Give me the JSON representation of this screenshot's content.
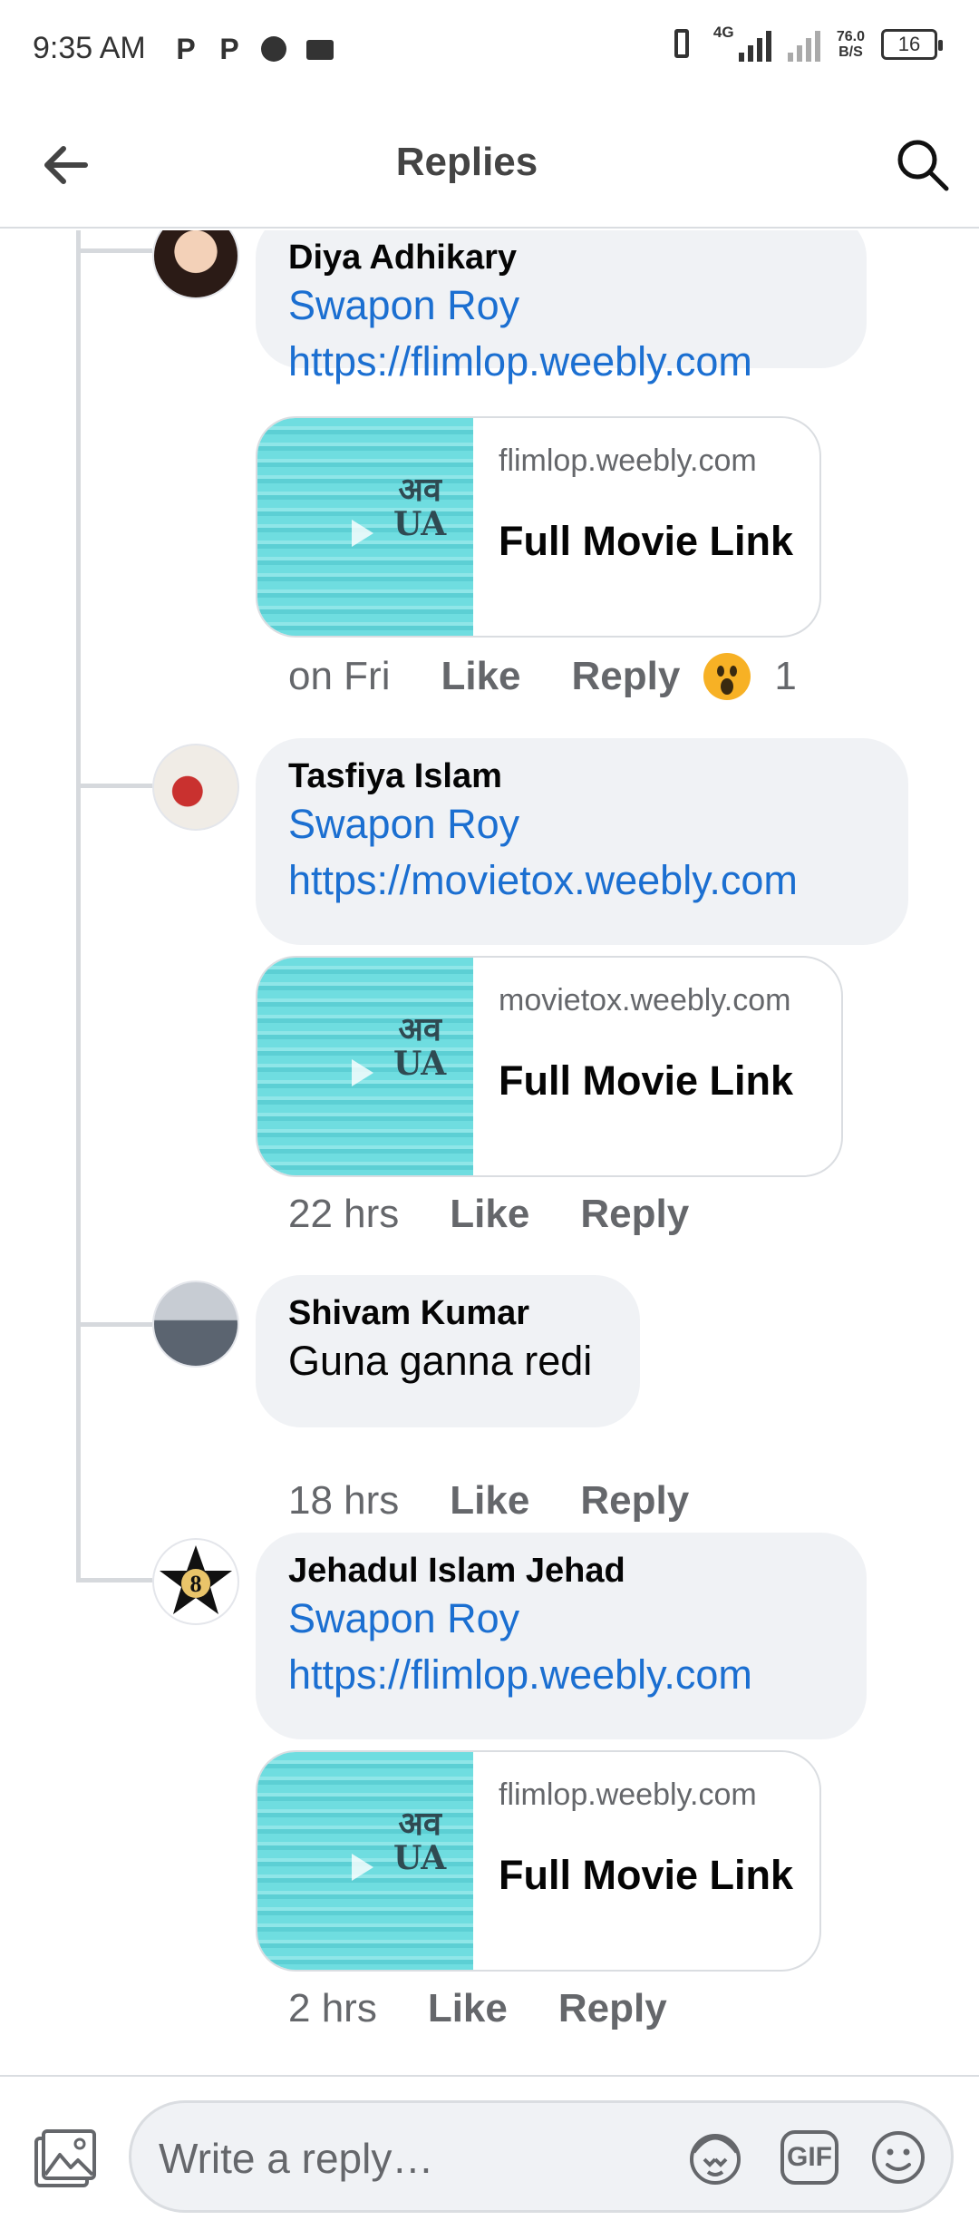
{
  "status_bar": {
    "time": "9:35 AM",
    "network": "4G",
    "speed_value": "76.0",
    "speed_unit": "B/S",
    "battery": "16",
    "icons": [
      "p-notification-icon",
      "p-notification-icon",
      "app-notification-icon",
      "mail-notification-icon",
      "vibrate-icon",
      "signal-icon",
      "signal-icon",
      "battery-icon"
    ]
  },
  "header": {
    "title": "Replies",
    "back_icon": "arrow-left-icon",
    "search_icon": "search-icon"
  },
  "comments": [
    {
      "author": "Diya Adhikary",
      "mention": "Swapon Roy",
      "link": "https://flimlop.weebly.com",
      "preview": {
        "domain": "flimlop.weebly.com",
        "title": "Full Movie Link",
        "thumb_text": [
          "अव",
          "UA"
        ]
      },
      "time": "on Fri",
      "like_label": "Like",
      "reply_label": "Reply",
      "reaction_icon": "wow-reaction-icon",
      "reaction_count": "1"
    },
    {
      "author": "Tasfiya Islam",
      "mention": "Swapon Roy",
      "link": "https://movietox.weebly.com",
      "preview": {
        "domain": "movietox.weebly.com",
        "title": "Full Movie Link",
        "thumb_text": [
          "अव",
          "UA"
        ]
      },
      "time": "22 hrs",
      "like_label": "Like",
      "reply_label": "Reply"
    },
    {
      "author": "Shivam Kumar",
      "text": "Guna ganna redi",
      "time": "18 hrs",
      "like_label": "Like",
      "reply_label": "Reply"
    },
    {
      "author": "Jehadul Islam Jehad",
      "mention": "Swapon Roy",
      "link": "https://flimlop.weebly.com",
      "avatar_text": "8",
      "preview": {
        "domain": "flimlop.weebly.com",
        "title": "Full Movie Link",
        "thumb_text": [
          "अव",
          "UA"
        ]
      },
      "time": "2 hrs",
      "like_label": "Like",
      "reply_label": "Reply"
    }
  ],
  "composer": {
    "placeholder": "Write a reply…",
    "photo_icon": "photo-icon",
    "avatar_sticker_icon": "avatar-sticker-icon",
    "gif_label": "GIF",
    "emoji_icon": "smiley-icon"
  },
  "colors": {
    "link": "#1b6fd1",
    "bubble": "#f0f2f5",
    "secondary_text": "#65676b",
    "divider": "#dadde1"
  }
}
